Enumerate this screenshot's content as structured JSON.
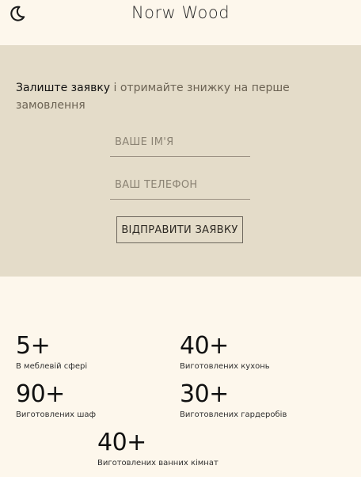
{
  "header": {
    "brand": "Norw Wood",
    "theme_icon": "moon-icon"
  },
  "form": {
    "heading_strong": "Залиште заявку",
    "heading_rest": " і отримайте знижку на перше замовлення",
    "name_placeholder": "ВАШЕ ІМ'Я",
    "phone_placeholder": "ВАШ ТЕЛЕФОН",
    "submit_label": "ВІДПРАВИТИ ЗАЯВКУ",
    "background_color": "#e4dcc9"
  },
  "stats": [
    {
      "value": "5+",
      "label": "В меблевій сфері"
    },
    {
      "value": "40+",
      "label": "Виготовлених кухонь"
    },
    {
      "value": "90+",
      "label": "Виготовлених шаф"
    },
    {
      "value": "30+",
      "label": "Виготовлених гардеробів"
    },
    {
      "value": "40+",
      "label": "Виготовлених ванних кімнат"
    }
  ]
}
